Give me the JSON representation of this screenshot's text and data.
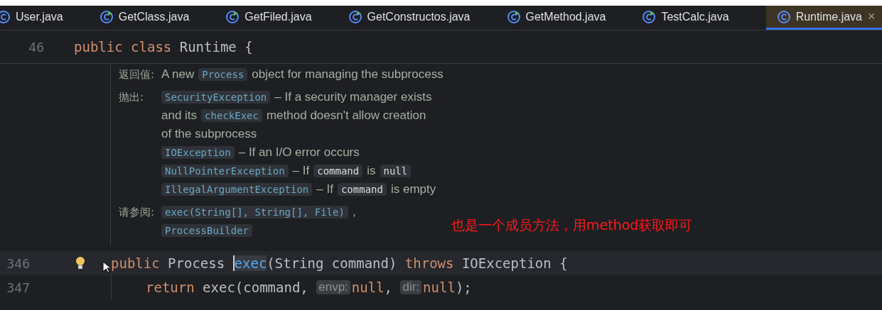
{
  "tabs": [
    {
      "label": "User.java",
      "kind": "class",
      "selected": false
    },
    {
      "label": "GetClass.java",
      "kind": "runnable",
      "selected": false
    },
    {
      "label": "GetFiled.java",
      "kind": "runnable",
      "selected": false
    },
    {
      "label": "GetConstructos.java",
      "kind": "runnable",
      "selected": false
    },
    {
      "label": "GetMethod.java",
      "kind": "runnable",
      "selected": false
    },
    {
      "label": "TestCalc.java",
      "kind": "runnable",
      "selected": false
    },
    {
      "label": "Runtime.java",
      "kind": "class",
      "selected": true,
      "close": "×"
    }
  ],
  "sticky_line": {
    "number": "46",
    "tokens": [
      {
        "kind": "keyword",
        "text": "public class "
      },
      {
        "kind": "plain",
        "text": "Runtime {"
      }
    ]
  },
  "doc": [
    {
      "label": "返回值:",
      "lines": [
        [
          {
            "kind": "text",
            "text": "A new"
          },
          {
            "kind": "code",
            "text": "Process"
          },
          {
            "kind": "text",
            "text": "object for managing the subprocess"
          }
        ]
      ]
    },
    {
      "label": "抛出:",
      "lines": [
        [
          {
            "kind": "code",
            "text": "SecurityException"
          },
          {
            "kind": "text",
            "text": "– If a security manager exists"
          }
        ],
        [
          {
            "kind": "text",
            "text": "and its"
          },
          {
            "kind": "code",
            "text": "checkExec"
          },
          {
            "kind": "text",
            "text": "method doesn't allow creation"
          }
        ],
        [
          {
            "kind": "text",
            "text": "of the subprocess"
          }
        ],
        [
          {
            "kind": "code",
            "text": "IOException"
          },
          {
            "kind": "text",
            "text": "– If an I/O error occurs"
          }
        ],
        [
          {
            "kind": "code",
            "text": "NullPointerException"
          },
          {
            "kind": "text",
            "text": "– If"
          },
          {
            "kind": "param",
            "text": "command"
          },
          {
            "kind": "text",
            "text": "is"
          },
          {
            "kind": "param",
            "text": "null"
          }
        ],
        [
          {
            "kind": "code",
            "text": "IllegalArgumentException"
          },
          {
            "kind": "text",
            "text": "– If"
          },
          {
            "kind": "param",
            "text": "command"
          },
          {
            "kind": "text",
            "text": "is empty"
          }
        ]
      ]
    },
    {
      "label": "请参阅:",
      "lines": [
        [
          {
            "kind": "code",
            "text": "exec(String[], String[], File)"
          },
          {
            "kind": "text",
            "text": ","
          }
        ],
        [
          {
            "kind": "code",
            "text": "ProcessBuilder"
          }
        ]
      ]
    }
  ],
  "annotation": "也是一个成员方法，用method获取即可",
  "code_lines": [
    {
      "number": "346",
      "current": true,
      "bulb": true,
      "indented": false,
      "tokens": [
        {
          "kind": "keyword",
          "text": "public "
        },
        {
          "kind": "plain",
          "text": "Process "
        },
        {
          "kind": "usage",
          "text": "exec"
        },
        {
          "kind": "plain",
          "text": "(String command) "
        },
        {
          "kind": "keyword",
          "text": "throws "
        },
        {
          "kind": "plain",
          "text": "IOException {"
        }
      ]
    },
    {
      "number": "347",
      "current": false,
      "bulb": false,
      "indented": true,
      "tokens": [
        {
          "kind": "keyword",
          "text": "return "
        },
        {
          "kind": "plain",
          "text": "exec(command, "
        },
        {
          "kind": "hint",
          "text": "envp:"
        },
        {
          "kind": "keyword",
          "text": "null"
        },
        {
          "kind": "plain",
          "text": ", "
        },
        {
          "kind": "hint",
          "text": "dir:"
        },
        {
          "kind": "keyword",
          "text": "null"
        },
        {
          "kind": "plain",
          "text": ");"
        }
      ]
    }
  ]
}
